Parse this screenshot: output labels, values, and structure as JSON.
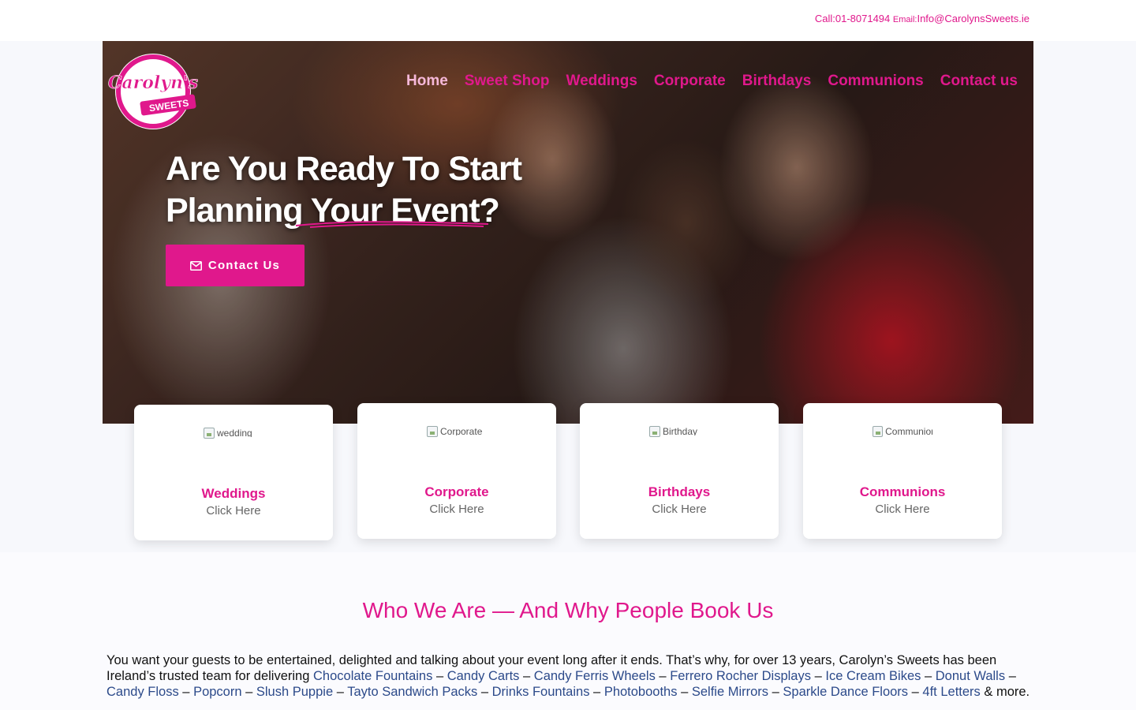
{
  "topbar": {
    "call_label": "Call:",
    "phone": "01-8071494",
    "email_label": "Email:",
    "email": "Info@CarolynsSweets.ie"
  },
  "logo": {
    "line1": "Carolyn's",
    "line2": "SWEETS"
  },
  "nav": {
    "items": [
      {
        "label": "Home",
        "active": true
      },
      {
        "label": "Sweet Shop"
      },
      {
        "label": "Weddings"
      },
      {
        "label": "Corporate"
      },
      {
        "label": "Birthdays"
      },
      {
        "label": "Communions"
      },
      {
        "label": "Contact us"
      }
    ]
  },
  "hero": {
    "line1": "Are You Ready To Start",
    "line2": "Planning  Your Event?",
    "cta_label": "Contact Us",
    "cta_icon": "envelope-icon"
  },
  "cards": [
    {
      "title": "Weddings",
      "subtitle": "Click Here",
      "img_alt": "wedding"
    },
    {
      "title": "Corporate",
      "subtitle": "Click Here",
      "img_alt": "Corporate"
    },
    {
      "title": "Birthdays",
      "subtitle": "Click Here",
      "img_alt": "Birthday"
    },
    {
      "title": "Communions",
      "subtitle": "Click Here",
      "img_alt": "Communion"
    }
  ],
  "about": {
    "heading": "Who We Are — And Why People Book Us",
    "intro": "You want your guests to be entertained, delighted and talking about your event long after it ends. That’s why, for over 13 years, Carolyn’s Sweets has been Ireland’s trusted team for delivering ",
    "links": [
      "Chocolate Fountains",
      "Candy Carts",
      "Candy Ferris Wheels",
      "Ferrero Rocher Displays",
      "Ice Cream Bikes",
      "Donut Walls",
      "Candy Floss",
      "Popcorn",
      "Slush Puppie",
      "Tayto Sandwich Packs",
      "Drinks Fountains",
      "Photobooths",
      "Selfie Mirrors",
      "Sparkle Dance Floors",
      "4ft Letters"
    ],
    "separator": " – ",
    "outro": " & more."
  },
  "colors": {
    "brand_pink": "#e0188c",
    "link_blue": "#2c4a8a"
  }
}
